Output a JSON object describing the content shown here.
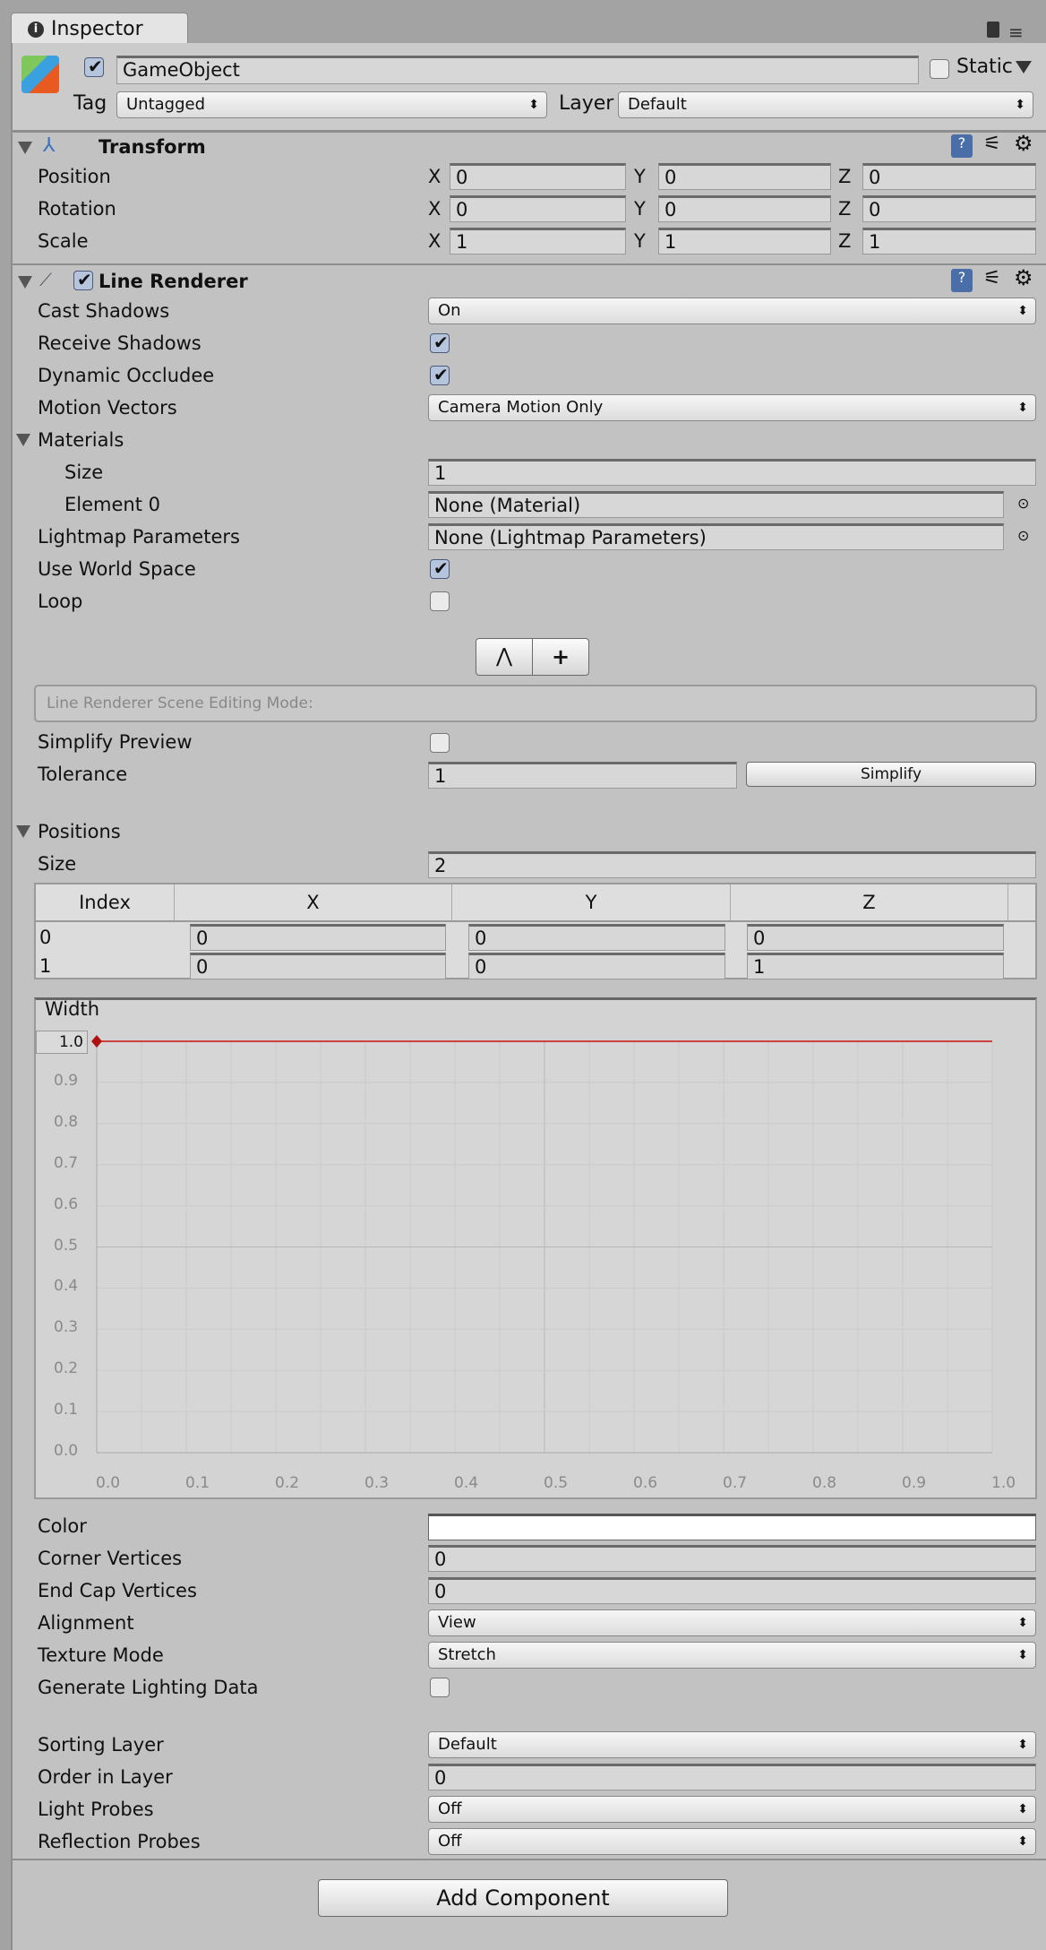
{
  "tab": {
    "title": "Inspector"
  },
  "object": {
    "name": "GameObject",
    "active": true,
    "static_label": "Static",
    "static": false,
    "tag_label": "Tag",
    "tag": "Untagged",
    "layer_label": "Layer",
    "layer": "Default"
  },
  "transform": {
    "title": "Transform",
    "rows": [
      {
        "label": "Position",
        "x": "0",
        "y": "0",
        "z": "0"
      },
      {
        "label": "Rotation",
        "x": "0",
        "y": "0",
        "z": "0"
      },
      {
        "label": "Scale",
        "x": "1",
        "y": "1",
        "z": "1"
      }
    ],
    "axes": {
      "x": "X",
      "y": "Y",
      "z": "Z"
    }
  },
  "line_renderer": {
    "title": "Line Renderer",
    "enabled": true,
    "cast_shadows": {
      "label": "Cast Shadows",
      "value": "On"
    },
    "receive_shadows": {
      "label": "Receive Shadows",
      "checked": true
    },
    "dynamic_occludee": {
      "label": "Dynamic Occludee",
      "checked": true
    },
    "motion_vectors": {
      "label": "Motion Vectors",
      "value": "Camera Motion Only"
    },
    "materials": {
      "label": "Materials",
      "size_label": "Size",
      "size": "1",
      "element_label": "Element 0",
      "element": "None (Material)"
    },
    "lightmap": {
      "label": "Lightmap Parameters",
      "value": "None (Lightmap Parameters)"
    },
    "world_space": {
      "label": "Use World Space",
      "checked": true
    },
    "loop": {
      "label": "Loop",
      "checked": false
    },
    "edit_mode_text": "Line Renderer Scene Editing Mode:",
    "simplify_preview": {
      "label": "Simplify Preview",
      "checked": false
    },
    "tolerance": {
      "label": "Tolerance",
      "value": "1",
      "button": "Simplify"
    },
    "positions": {
      "label": "Positions",
      "size_label": "Size",
      "size": "2",
      "headers": [
        "Index",
        "X",
        "Y",
        "Z"
      ],
      "rows": [
        {
          "index": "0",
          "x": "0",
          "y": "0",
          "z": "0"
        },
        {
          "index": "1",
          "x": "0",
          "y": "0",
          "z": "1"
        }
      ]
    },
    "width_label": "Width",
    "width_value": "1.0",
    "color": {
      "label": "Color",
      "value": "#ffffff"
    },
    "corner": {
      "label": "Corner Vertices",
      "value": "0"
    },
    "endcap": {
      "label": "End Cap Vertices",
      "value": "0"
    },
    "alignment": {
      "label": "Alignment",
      "value": "View"
    },
    "texture_mode": {
      "label": "Texture Mode",
      "value": "Stretch"
    },
    "gen_lighting": {
      "label": "Generate Lighting Data",
      "checked": false
    },
    "sorting_layer": {
      "label": "Sorting Layer",
      "value": "Default"
    },
    "order": {
      "label": "Order in Layer",
      "value": "0"
    },
    "light_probes": {
      "label": "Light Probes",
      "value": "Off"
    },
    "reflection_probes": {
      "label": "Reflection Probes",
      "value": "Off"
    }
  },
  "add_component": "Add Component",
  "chart_data": {
    "type": "line",
    "title": "Width",
    "series": [
      {
        "name": "Width",
        "x": [
          0.0,
          1.0
        ],
        "y": [
          1.0,
          1.0
        ],
        "color": "#cc1111"
      }
    ],
    "xlim": [
      0,
      1
    ],
    "ylim": [
      0,
      1
    ],
    "xticks": [
      "0.0",
      "0.1",
      "0.2",
      "0.3",
      "0.4",
      "0.5",
      "0.6",
      "0.7",
      "0.8",
      "0.9",
      "1.0"
    ],
    "yticks": [
      "0.0",
      "0.1",
      "0.2",
      "0.3",
      "0.4",
      "0.5",
      "0.6",
      "0.7",
      "0.8",
      "0.9"
    ],
    "grid": true
  }
}
